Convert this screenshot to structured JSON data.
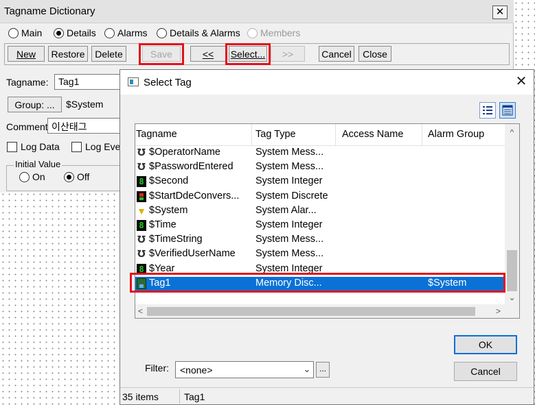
{
  "background_window": {
    "title": "Tagname Dictionary",
    "close_glyph": "✕",
    "modes": [
      {
        "label": "Main",
        "checked": false,
        "enabled": true
      },
      {
        "label": "Details",
        "checked": true,
        "enabled": true
      },
      {
        "label": "Alarms",
        "checked": false,
        "enabled": true
      },
      {
        "label": "Details & Alarms",
        "checked": false,
        "enabled": true
      },
      {
        "label": "Members",
        "checked": false,
        "enabled": false
      }
    ],
    "toolbar": {
      "new_label": "New",
      "restore_label": "Restore",
      "delete_label": "Delete",
      "save_label": "Save",
      "prev_label": "<<",
      "select_label": "Select...",
      "next_label": ">>",
      "cancel_label": "Cancel",
      "close_label": "Close"
    },
    "form": {
      "tagname_label": "Tagname:",
      "tagname_value": "Tag1",
      "group_button_label": "Group: ...",
      "group_value": "$System",
      "comment_label": "Comment:",
      "comment_value": "이산태그",
      "log_data_label": "Log Data",
      "log_events_label": "Log Eve",
      "initial_value_label": "Initial Value",
      "on_label": "On",
      "off_label": "Off"
    }
  },
  "dialog": {
    "title": "Select Tag",
    "close_glyph": "✕",
    "view_buttons": [
      {
        "icon": "details-view-icon",
        "active": false
      },
      {
        "icon": "list-view-icon",
        "active": true
      }
    ],
    "columns": {
      "tagname": "Tagname",
      "tag_type": "Tag Type",
      "access_name": "Access Name",
      "alarm_group": "Alarm Group"
    },
    "rows": [
      {
        "icon": "message-tag-icon",
        "tagname": "$OperatorName",
        "tag_type": "System Mess...",
        "access_name": "",
        "alarm_group": "",
        "selected": false
      },
      {
        "icon": "message-tag-icon",
        "tagname": "$PasswordEntered",
        "tag_type": "System Mess...",
        "access_name": "",
        "alarm_group": "",
        "selected": false
      },
      {
        "icon": "integer-tag-icon",
        "tagname": "$Second",
        "tag_type": "System Integer",
        "access_name": "",
        "alarm_group": "",
        "selected": false
      },
      {
        "icon": "discrete-tag-icon",
        "tagname": "$StartDdeConvers...",
        "tag_type": "System Discrete",
        "access_name": "",
        "alarm_group": "",
        "selected": false
      },
      {
        "icon": "alarm-tag-icon",
        "tagname": "$System",
        "tag_type": "System Alar...",
        "access_name": "",
        "alarm_group": "",
        "selected": false
      },
      {
        "icon": "integer-tag-icon",
        "tagname": "$Time",
        "tag_type": "System Integer",
        "access_name": "",
        "alarm_group": "",
        "selected": false
      },
      {
        "icon": "message-tag-icon",
        "tagname": "$TimeString",
        "tag_type": "System Mess...",
        "access_name": "",
        "alarm_group": "",
        "selected": false
      },
      {
        "icon": "message-tag-icon",
        "tagname": "$VerifiedUserName",
        "tag_type": "System Mess...",
        "access_name": "",
        "alarm_group": "",
        "selected": false
      },
      {
        "icon": "integer-tag-icon",
        "tagname": "$Year",
        "tag_type": "System Integer",
        "access_name": "",
        "alarm_group": "",
        "selected": false
      },
      {
        "icon": "memory-discrete-tag-icon",
        "tagname": "Tag1",
        "tag_type": "Memory Disc...",
        "access_name": "",
        "alarm_group": "$System",
        "selected": true
      }
    ],
    "ok_label": "OK",
    "cancel_label": "Cancel",
    "filter_label": "Filter:",
    "filter_value": "<none>",
    "filter_browse_label": "...",
    "status": {
      "count": "35 items",
      "selected_tag": "Tag1"
    },
    "colors": {
      "selection": "#0a71d6",
      "highlight_box": "#e3111a",
      "default_button_border": "#0a6fd8"
    }
  }
}
